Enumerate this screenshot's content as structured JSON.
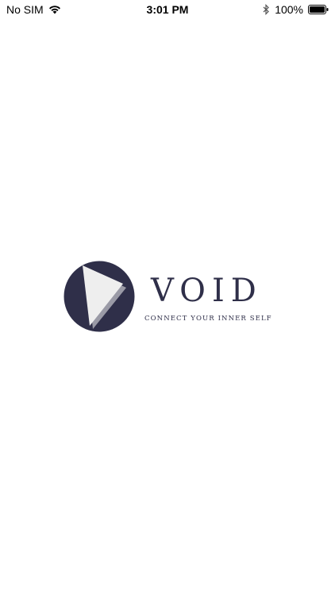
{
  "status_bar": {
    "carrier": "No SIM",
    "time": "3:01 PM",
    "battery_percent": "100%",
    "icons": [
      "wifi-icon",
      "bluetooth-icon",
      "battery-icon"
    ],
    "battery_level": 1.0
  },
  "splash": {
    "brand_name": "VOID",
    "tagline": "CONNECT YOUR INNER SELF",
    "logo_icon": "void-logo-icon",
    "colors": {
      "brand_navy": "#2f2f49",
      "triangle_light": "#eeeeee",
      "triangle_shadow": "#9a9aa6"
    }
  }
}
